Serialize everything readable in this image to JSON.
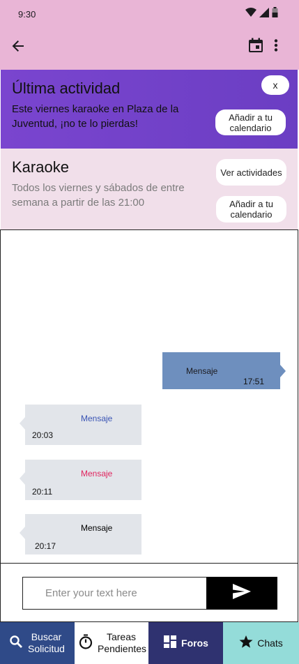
{
  "status_bar": {
    "time": "9:30",
    "icons": [
      "wifi-icon",
      "signal-icon",
      "battery-icon"
    ]
  },
  "app_bar": {
    "icons": [
      "back-arrow-icon",
      "calendar-icon",
      "more-vert-icon"
    ]
  },
  "activity_banner": {
    "title": "Última actividad",
    "text": "Este viernes karaoke en Plaza de la Juventud, ¡no te lo pierdas!",
    "close_label": "x",
    "add_calendar_label": "Añadir a tu calendario"
  },
  "event": {
    "title": "Karaoke",
    "description": "Todos los viernes y sábados de entre semana a partir de las 21:00",
    "ver_actividades_label": "Ver actividades",
    "add_calendar_label": "Añadir a tu calendario"
  },
  "messages": [
    {
      "direction": "outgoing",
      "text": "Mensaje",
      "time": "17:51",
      "color": "#000000"
    },
    {
      "direction": "incoming",
      "text": "Mensaje",
      "time": "20:03",
      "color": "#3a54b4"
    },
    {
      "direction": "incoming",
      "text": "Mensaje",
      "time": "20:11",
      "color": "#e0245e"
    },
    {
      "direction": "incoming",
      "text": "Mensaje",
      "time": "20:17",
      "color": "#000000"
    }
  ],
  "composer": {
    "placeholder": "Enter your text here",
    "value": ""
  },
  "bottom_nav": [
    {
      "label": "Buscar Solicitud",
      "icon": "search-icon"
    },
    {
      "label": "Tareas Pendientes",
      "icon": "timer-icon"
    },
    {
      "label": "Foros",
      "icon": "dashboard-icon"
    },
    {
      "label": "Chats",
      "icon": "star-icon"
    }
  ],
  "colors": {
    "top_bar": "#e9b5d6",
    "banner": "#7a45cf",
    "event_card": "#f1dfea",
    "outgoing_bubble": "#6e8fbe",
    "incoming_bubble": "#e2e5ea",
    "nav_buscar": "#2f4a88",
    "nav_foros": "#2f3270",
    "nav_chats": "#94dcd9"
  }
}
